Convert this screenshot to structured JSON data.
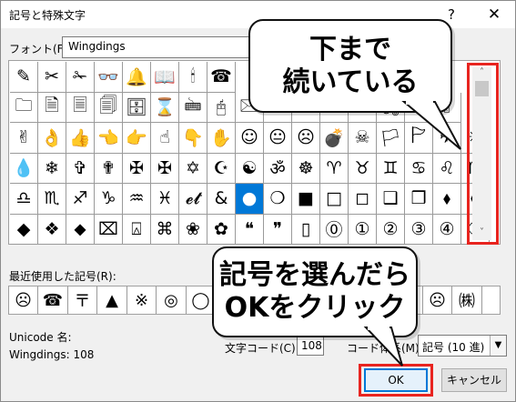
{
  "dialog": {
    "title": "記号と特殊文字",
    "help_glyph": "?",
    "close_glyph": "✕"
  },
  "font": {
    "label": "フォント(F):",
    "value": "Wingdings"
  },
  "grid": {
    "rows": [
      [
        "✎",
        "✂",
        "✁",
        "👓",
        "🔔",
        "📖",
        "🕯",
        "☎"
      ],
      [
        "🗀",
        "🗎",
        "🗏",
        "🗐",
        "🗄",
        "⌛",
        "🖮",
        "🖰",
        "🖂",
        "🖃",
        "🖄",
        "🖅",
        "🖆",
        "🖇",
        "✍",
        "✌"
      ],
      [
        "✌",
        "👌",
        "👍",
        "👈",
        "👉",
        "☝",
        "👇",
        "✋",
        "☺",
        "😐",
        "☹",
        "💣",
        "☠",
        "🏳",
        "🏱",
        "✈",
        "☼"
      ],
      [
        "💧",
        "❄",
        "✞",
        "✟",
        "✠",
        "✠",
        "✡",
        "☪",
        "☯",
        "ॐ",
        "☸",
        "♈",
        "♉",
        "♊",
        "♋",
        "♌",
        "♍"
      ],
      [
        "♎",
        "♏",
        "♐",
        "♑",
        "♒",
        "♓",
        "𝓮𝓽",
        "&",
        "●",
        "❍",
        "■",
        "□",
        "◻",
        "❑",
        "❒",
        "⬧",
        "⧫"
      ],
      [
        "◆",
        "❖",
        "⬥",
        "⌧",
        "⍓",
        "⌘",
        "❀",
        "✿",
        "❝",
        "❞",
        "▯",
        "⓪",
        "①",
        "②",
        "③",
        "④",
        "⑤"
      ]
    ],
    "selected": {
      "row": 4,
      "col": 8
    }
  },
  "scrollbar": {
    "up": "˄",
    "down": "˅"
  },
  "recent": {
    "label": "最近使用した記号(R):",
    "items": [
      "☹",
      "☎",
      "〒",
      "▲",
      "※",
      "◎",
      "◯",
      "",
      "",
      "",
      "",
      "",
      "",
      "☺",
      "☹",
      "㈱"
    ]
  },
  "info": {
    "unicode_name_label": "Unicode 名:",
    "wingdings_code": "Wingdings: 108",
    "char_code_label": "文字コード(C):",
    "char_code_value": "108",
    "from_label": "コード体系(M):",
    "from_value": "記号 (10 進)"
  },
  "buttons": {
    "ok": "OK",
    "cancel": "キャンセル"
  },
  "callouts": {
    "scroll": {
      "line1": "下まで",
      "line2": "続いている"
    },
    "ok": {
      "line1": "記号を選んだら",
      "line2": "OKをクリック"
    }
  },
  "colors": {
    "highlight": "#e8241f",
    "selection": "#0078d7"
  }
}
